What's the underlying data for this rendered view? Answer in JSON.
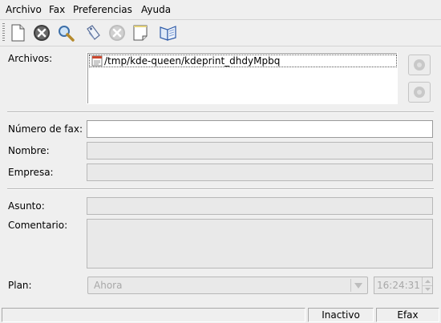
{
  "menubar": {
    "items": [
      "Archivo",
      "Fax",
      "Preferencias",
      "Ayuda"
    ]
  },
  "toolbar": {
    "buttons": [
      "new-document-icon",
      "cancel-icon",
      "zoom-icon",
      "tag-icon",
      "cancel-disabled-icon",
      "page-icon",
      "address-book-icon"
    ]
  },
  "files": {
    "label": "Archivos:",
    "items": [
      "/tmp/kde-queen/kdeprint_dhdyMpbq"
    ]
  },
  "form": {
    "fax_number_label": "Número de fax:",
    "fax_number_value": "",
    "name_label": "Nombre:",
    "name_value": "",
    "company_label": "Empresa:",
    "company_value": "",
    "subject_label": "Asunto:",
    "subject_value": "",
    "comment_label": "Comentario:",
    "comment_value": "",
    "plan_label": "Plan:",
    "plan_value": "Ahora",
    "time_value": "16:24:31"
  },
  "status": {
    "state": "Inactivo",
    "program": "Efax"
  }
}
